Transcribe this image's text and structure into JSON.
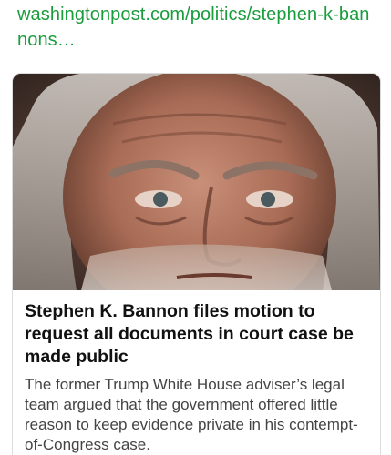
{
  "link": {
    "url_text": "washingtonpost.com/politics/stephen-k-bannons…"
  },
  "card": {
    "image_icon": "news-photo",
    "headline": "Stephen K. Bannon files motion to request all documents in court case be made public",
    "summary": "The former Trump White House adviser’s legal team argued that the government offered little reason to keep evidence private in his contempt-of-Congress case."
  },
  "colors": {
    "link": "#1a9c3c",
    "headline": "#111111",
    "summary": "#444444",
    "card_border": "#dcdcdc"
  }
}
